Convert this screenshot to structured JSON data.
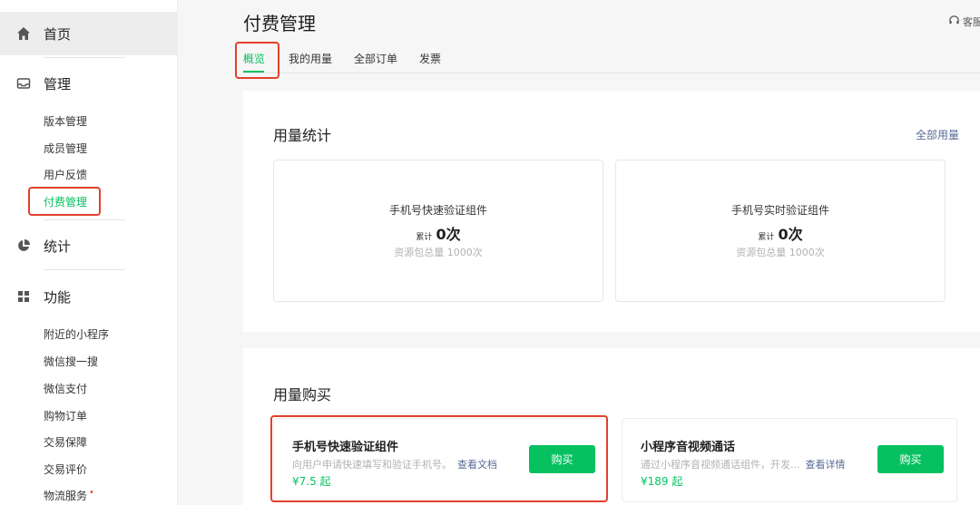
{
  "sidebar": {
    "home": "首页",
    "manage": {
      "title": "管理",
      "items": [
        "版本管理",
        "成员管理",
        "用户反馈",
        "付费管理"
      ]
    },
    "stats": {
      "title": "统计"
    },
    "features": {
      "title": "功能",
      "items": [
        "附近的小程序",
        "微信搜一搜",
        "微信支付",
        "购物订单",
        "交易保障",
        "交易评价",
        "物流服务"
      ]
    },
    "badge": "•"
  },
  "header": {
    "title": "付费管理",
    "service": "客服"
  },
  "tabs": [
    "概览",
    "我的用量",
    "全部订单",
    "发票"
  ],
  "usage": {
    "title": "用量统计",
    "all_link": "全部用量",
    "boxes": [
      {
        "name": "手机号快速验证组件",
        "count_label": "累计",
        "count": "0次",
        "quota": "资源包总量 1000次"
      },
      {
        "name": "手机号实时验证组件",
        "count_label": "累计",
        "count": "0次",
        "quota": "资源包总量 1000次"
      }
    ]
  },
  "purchase": {
    "title": "用量购买",
    "products": [
      {
        "name": "手机号快速验证组件",
        "desc": "向用户申请快速填写和验证手机号。",
        "link": "查看文档",
        "price": "¥7.5 起",
        "button": "购买"
      },
      {
        "name": "小程序音视频通话",
        "desc": "通过小程序音视频通话组件，开发...",
        "link": "查看详情",
        "price": "¥189 起",
        "button": "购买"
      }
    ]
  },
  "colors": {
    "accent": "#07c160",
    "link": "#576b95",
    "highlight": "#e2412b"
  }
}
